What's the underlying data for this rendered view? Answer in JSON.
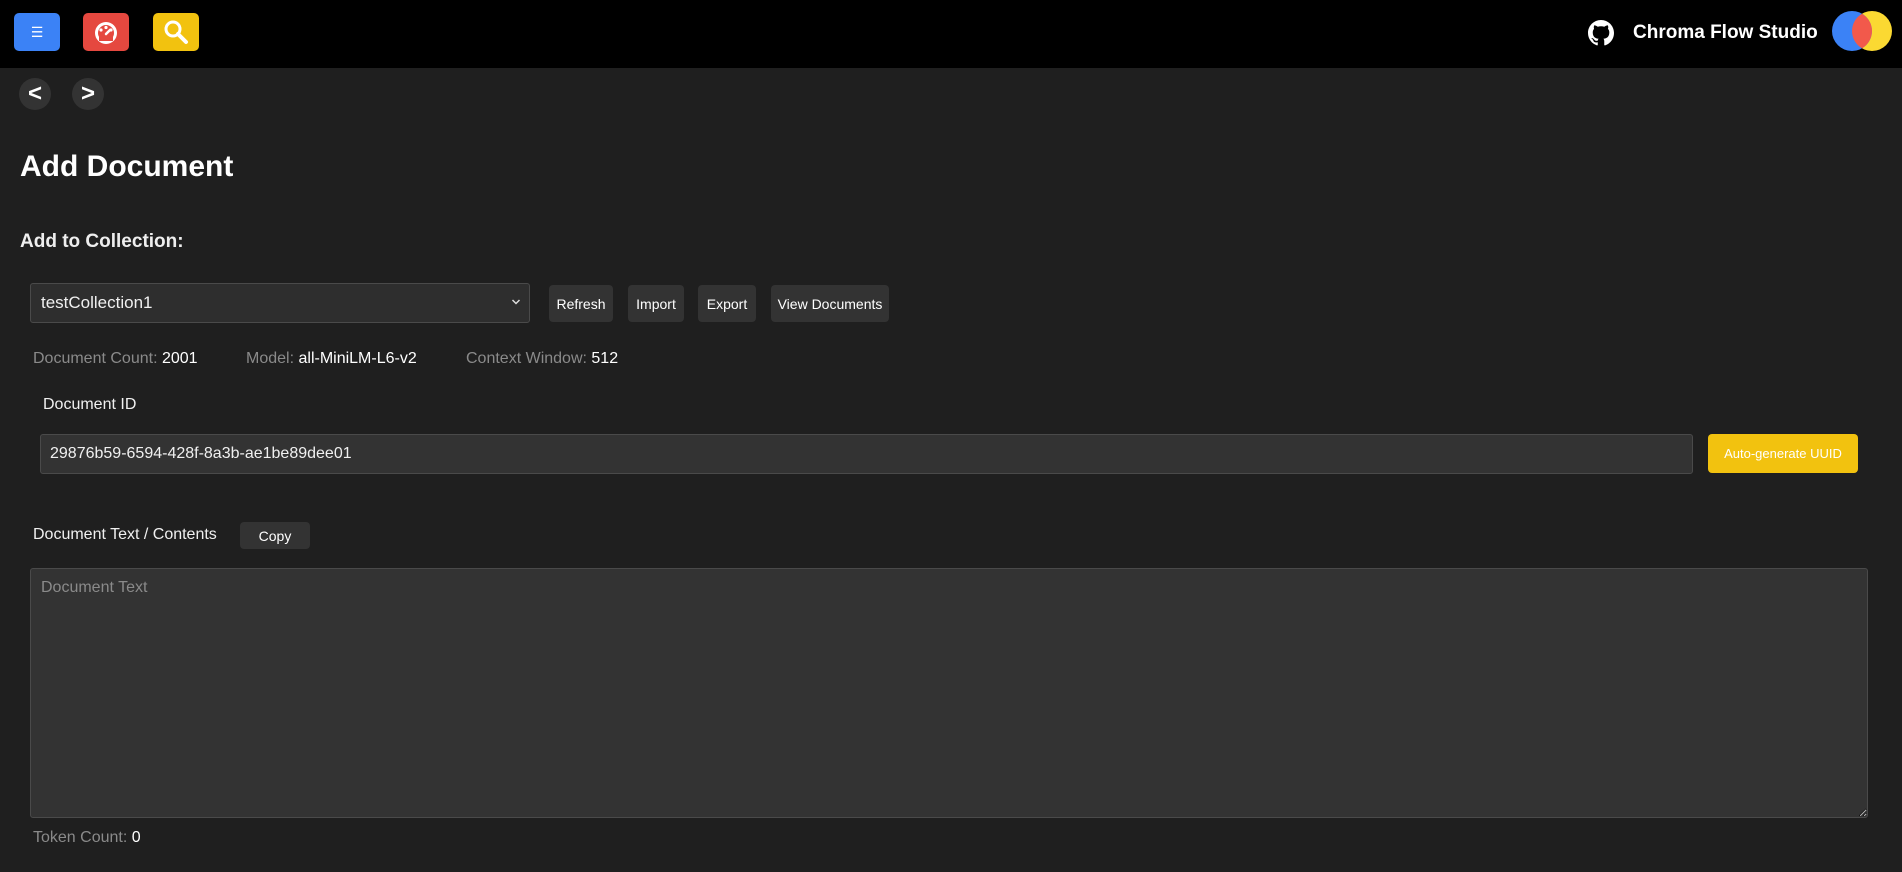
{
  "app": {
    "brand": "Chroma Flow Studio",
    "menu_icon": "hamburger-icon",
    "dashboard_icon": "dashboard-gauge-icon",
    "search_icon": "search-icon",
    "github_icon": "github-icon",
    "colors": {
      "menu_button": "#3b82f6",
      "dashboard_button": "#e5483f",
      "search_button": "#f2c20f",
      "accent_button": "#f2c20f"
    }
  },
  "nav": {
    "back": "<",
    "forward": ">"
  },
  "page": {
    "title": "Add Document",
    "collection_label": "Add to Collection:"
  },
  "collection": {
    "selected": "testCollection1",
    "buttons": {
      "refresh": "Refresh",
      "import": "Import",
      "export": "Export",
      "view": "View Documents"
    }
  },
  "stats": {
    "doc_count_label": "Document Count:",
    "doc_count": "2001",
    "model_label": "Model:",
    "model": "all-MiniLM-L6-v2",
    "context_label": "Context Window:",
    "context": "512"
  },
  "document": {
    "id_label": "Document ID",
    "id_value": "29876b59-6594-428f-8a3b-ae1be89dee01",
    "uuid_button": "Auto-generate UUID",
    "text_label": "Document Text / Contents",
    "copy_button": "Copy",
    "text_placeholder": "Document Text",
    "token_label": "Token Count:",
    "token_count": "0"
  }
}
